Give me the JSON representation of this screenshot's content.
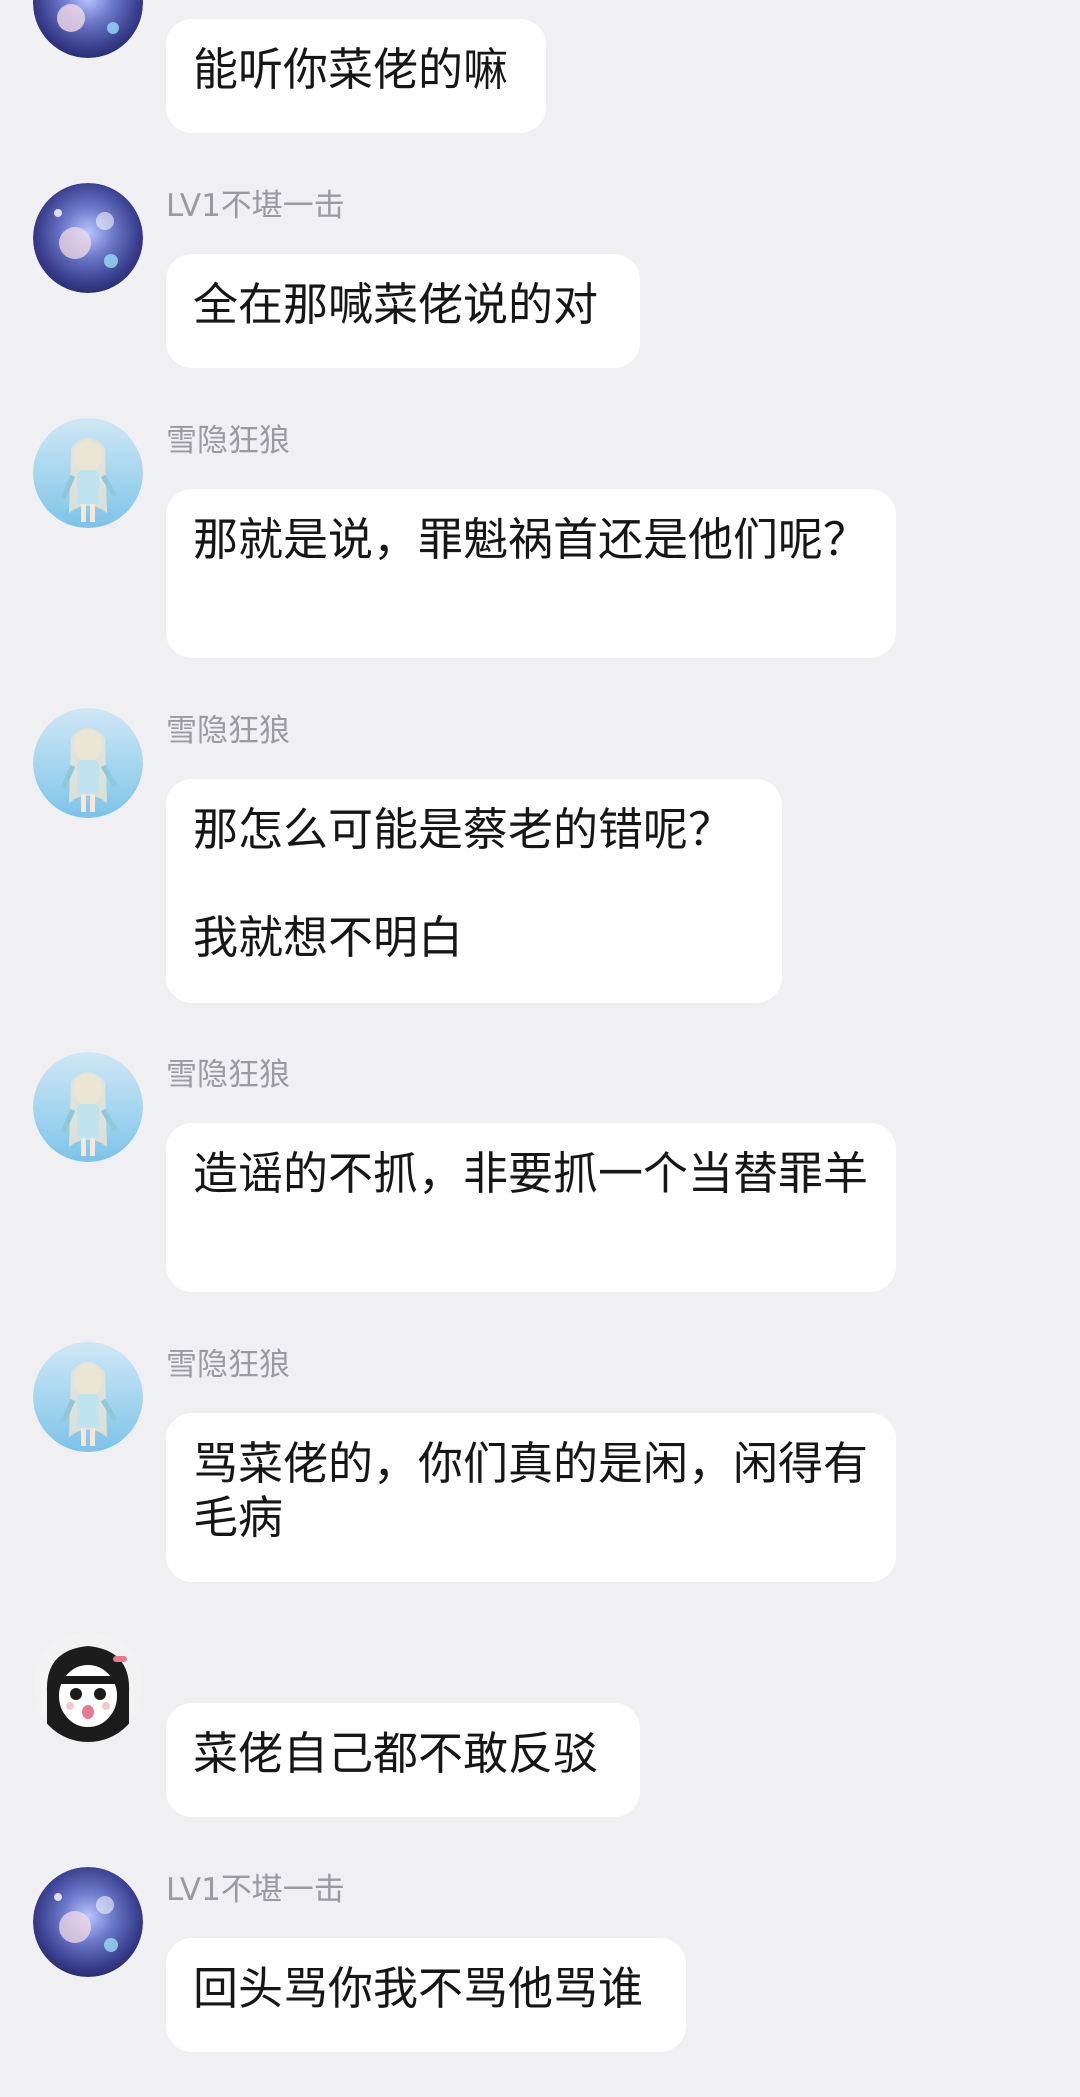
{
  "messages": [
    {
      "sender": "",
      "avatar": "galaxy-girl-avatar",
      "text": "能听你菜佬的嘛"
    },
    {
      "sender": "LV1不堪一击",
      "avatar": "galaxy-girl-avatar",
      "text": "全在那喊菜佬说的对"
    },
    {
      "sender": "雪隐狂狼",
      "avatar": "anime-girl-avatar",
      "text": "那就是说，罪魁祸首还是他们呢？"
    },
    {
      "sender": "雪隐狂狼",
      "avatar": "anime-girl-avatar",
      "text": "那怎么可能是蔡老的错呢？\n\n我就想不明白"
    },
    {
      "sender": "雪隐狂狼",
      "avatar": "anime-girl-avatar",
      "text": "造谣的不抓，非要抓一个当替罪羊"
    },
    {
      "sender": "雪隐狂狼",
      "avatar": "anime-girl-avatar",
      "text": "骂菜佬的，你们真的是闲，闲得有毛病"
    },
    {
      "sender": "",
      "avatar": "manga-girl-avatar",
      "text": "菜佬自己都不敢反驳"
    },
    {
      "sender": "LV1不堪一击",
      "avatar": "galaxy-girl-avatar",
      "text": "回头骂你我不骂他骂谁"
    }
  ]
}
